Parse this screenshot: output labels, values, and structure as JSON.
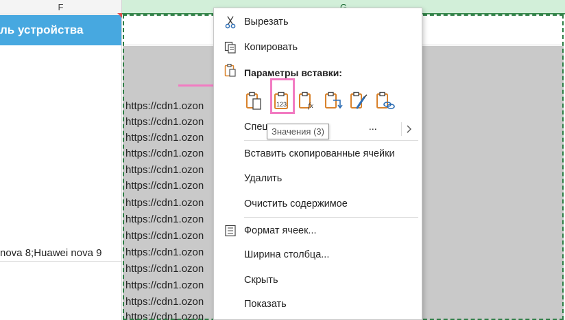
{
  "sheet": {
    "column_f_header": "F",
    "column_g_header": "G",
    "header_cell_f": "ль устройства",
    "cell_f_value": "nova 8;Huawei nova 9",
    "link_prefix": "https://cdn1.ozon",
    "link_rows": [
      "https://cdn1.ozon",
      "https://cdn1.ozon",
      "https://cdn1.ozon",
      "https://cdn1.ozon",
      "https://cdn1.ozon",
      "https://cdn1.ozon",
      "https://cdn1.ozon",
      "https://cdn1.ozon",
      "https://cdn1.ozon",
      "https://cdn1.ozon",
      "https://cdn1.ozon",
      "https://cdn1.ozon",
      "https://cdn1.ozon",
      "https://cdn1.ozon"
    ],
    "colors": {
      "header_blue": "#47a8e0",
      "selected_column": "#d2efd9",
      "gray_fill": "#c9c9c9",
      "marquee": "#2e7d45"
    }
  },
  "annotation": {
    "arrow_color": "#f27bc2"
  },
  "menu": {
    "cut": "Вырезать",
    "copy": "Копировать",
    "paste_options_title": "Параметры вставки:",
    "paste_special": "Специальная вставка...",
    "paste_special_visible": "Спец",
    "paste_special_tail": "...",
    "insert_copied": "Вставить скопированные ячейки",
    "delete": "Удалить",
    "clear_contents": "Очистить содержимое",
    "format_cells": "Формат ячеек...",
    "column_width": "Ширина столбца...",
    "hide": "Скрыть",
    "show": "Показать",
    "paste_icons": [
      "paste-icon",
      "paste-values-icon",
      "paste-formulas-icon",
      "paste-transpose-icon",
      "paste-formatting-icon",
      "paste-link-icon"
    ],
    "paste_values_badge": "123",
    "paste_formulas_badge": "fx"
  },
  "tooltip": {
    "text": "Значения (3)"
  }
}
